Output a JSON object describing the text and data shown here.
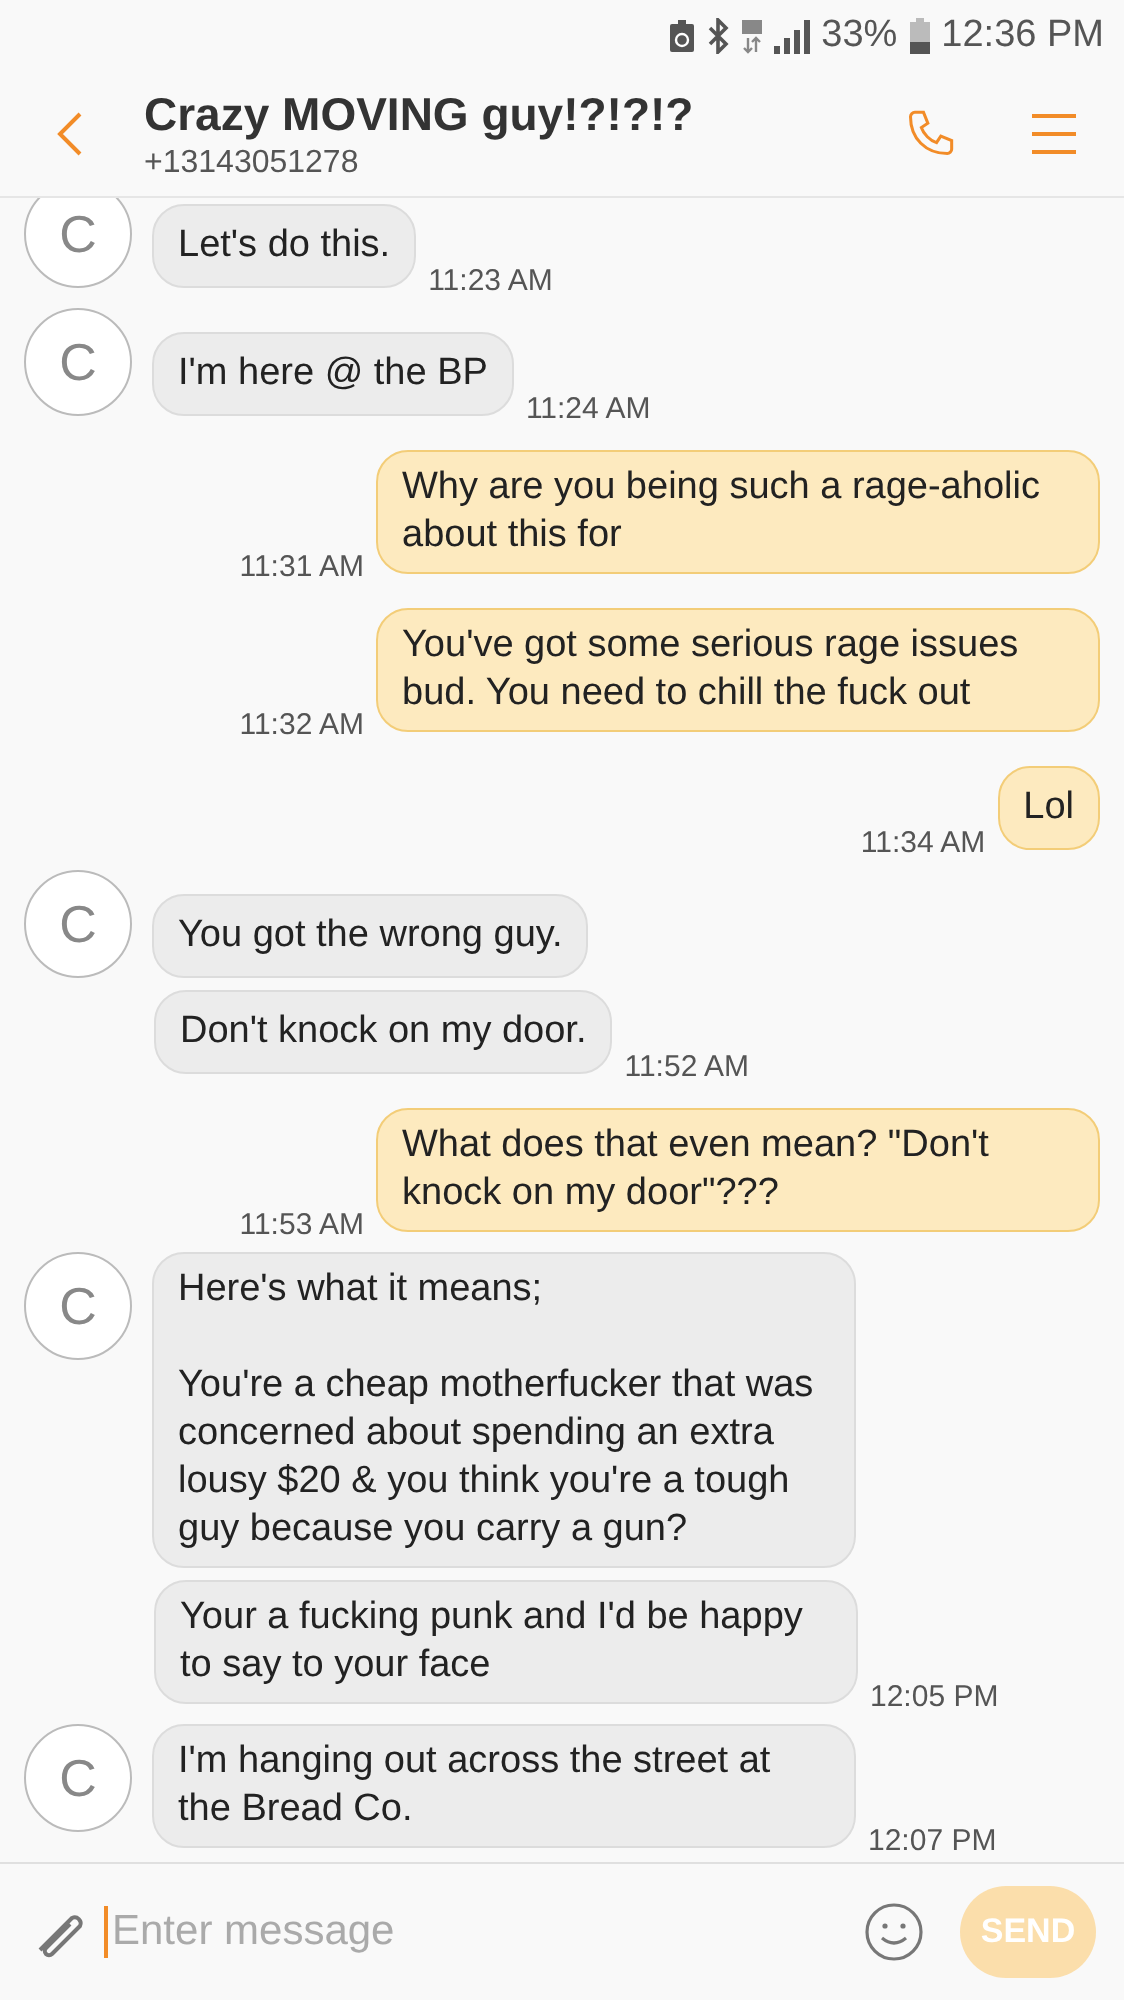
{
  "status_bar": {
    "battery": "33%",
    "time": "12:36 PM"
  },
  "header": {
    "title": "Crazy MOVING guy!?!?!?",
    "subtitle": "+13143051278"
  },
  "messages": [
    {
      "kind": "received",
      "avatar": "C",
      "text": "Let's do this.",
      "time": "11:23 AM"
    },
    {
      "kind": "received",
      "avatar": "C",
      "text": "I'm here @ the BP",
      "time": "11:24 AM"
    },
    {
      "kind": "sent",
      "text": "Why are you being such a rage-aholic about this for",
      "time": "11:31 AM"
    },
    {
      "kind": "sent",
      "text": "You've got some serious rage issues bud. You need to chill the fuck out",
      "time": "11:32 AM"
    },
    {
      "kind": "sent",
      "text": "Lol",
      "time": "11:34 AM"
    },
    {
      "kind": "received",
      "avatar": "C",
      "text": "You got the wrong guy."
    },
    {
      "kind": "received",
      "text": "Don't knock on my door.",
      "time": "11:52 AM"
    },
    {
      "kind": "sent",
      "text": "What does that even mean? \"Don't knock on my door\"???",
      "time": "11:53 AM"
    },
    {
      "kind": "received",
      "avatar": "C",
      "text": "Here's what it means;\n\nYou're a cheap motherfucker that was concerned about spending an extra lousy $20 & you think you're a tough guy because you carry a gun?"
    },
    {
      "kind": "received",
      "text": "Your a fucking punk and I'd be happy to say to your face",
      "time": "12:05 PM"
    },
    {
      "kind": "received",
      "avatar": "C",
      "text": "I'm hanging out across the street at the Bread Co.",
      "time": "12:07 PM"
    }
  ],
  "composer": {
    "placeholder": "Enter message",
    "send": "SEND"
  }
}
